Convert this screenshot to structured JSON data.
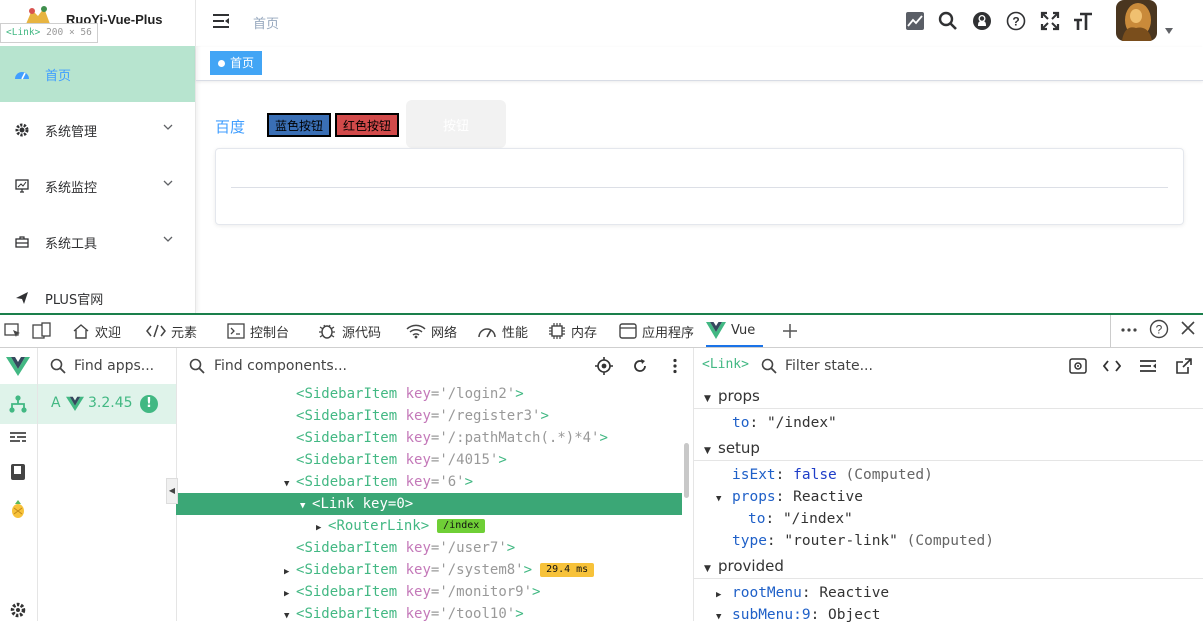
{
  "app": {
    "title": "RuoYi-Vue-Plus",
    "breadcrumb": "首页",
    "tag_home": "首页",
    "menu": [
      {
        "label": "首页",
        "icon": "dashboard-icon",
        "active": true
      },
      {
        "label": "系统管理",
        "icon": "gear-icon"
      },
      {
        "label": "系统监控",
        "icon": "monitor-icon"
      },
      {
        "label": "系统工具",
        "icon": "toolbox-icon"
      },
      {
        "label": "PLUS官网",
        "icon": "send-icon"
      }
    ],
    "header_icons": [
      "chart-icon",
      "search-icon",
      "github-icon",
      "help-icon",
      "fullscreen-icon",
      "font-size-icon"
    ],
    "main": {
      "link": "百度",
      "btn_blue": "蓝色按钮",
      "btn_red": "红色按钮",
      "btn_plain": "按钮"
    }
  },
  "inspect_tooltip": {
    "tag": "<Link>",
    "size": "200 × 56"
  },
  "devtools": {
    "tabs": [
      "欢迎",
      "元素",
      "控制台",
      "源代码",
      "网络",
      "性能",
      "内存",
      "应用程序",
      "Vue"
    ],
    "active_tab": "Vue",
    "find_apps_placeholder": "Find apps...",
    "app_letter": "A",
    "app_version": "3.2.45",
    "app_warning": "!",
    "find_components_placeholder": "Find components...",
    "tree": [
      {
        "indent": 0,
        "arrow": "",
        "name": "SidebarItem",
        "key": "'/login2'"
      },
      {
        "indent": 0,
        "arrow": "",
        "name": "SidebarItem",
        "key": "'/register3'"
      },
      {
        "indent": 0,
        "arrow": "",
        "name": "SidebarItem",
        "key": "'/:pathMatch(.*)*4'"
      },
      {
        "indent": 0,
        "arrow": "",
        "name": "SidebarItem",
        "key": "'/4015'"
      },
      {
        "indent": 0,
        "arrow": "▼",
        "name": "SidebarItem",
        "key": "'6'"
      },
      {
        "indent": 1,
        "arrow": "▼",
        "name": "Link",
        "key": "0",
        "selected": true
      },
      {
        "indent": 2,
        "arrow": "▶",
        "name": "RouterLink",
        "badge": "/index"
      },
      {
        "indent": 0,
        "arrow": "",
        "name": "SidebarItem",
        "key": "'/user7'"
      },
      {
        "indent": 0,
        "arrow": "▶",
        "name": "SidebarItem",
        "key": "'/system8'",
        "timing": "29.4 ms"
      },
      {
        "indent": 0,
        "arrow": "▶",
        "name": "SidebarItem",
        "key": "'/monitor9'"
      },
      {
        "indent": 0,
        "arrow": "▼",
        "name": "SidebarItem",
        "key": "'/tool10'"
      }
    ],
    "state_title": "<Link>",
    "filter_state_placeholder": "Filter state...",
    "sections": {
      "props": "props",
      "setup": "setup",
      "provided": "provided"
    },
    "props_rows": [
      {
        "key": "to",
        "value": "\"/index\""
      }
    ],
    "setup_rows": [
      {
        "key": "isExt",
        "value": "false",
        "note": "(Computed)"
      },
      {
        "key": "props",
        "value": "Reactive",
        "arrow": "▼"
      },
      {
        "key": "to",
        "value": "\"/index\"",
        "nested": true
      },
      {
        "key": "type",
        "value": "\"router-link\"",
        "note": "(Computed)"
      }
    ],
    "provided_rows": [
      {
        "key": "rootMenu",
        "value": "Reactive",
        "arrow": "▶"
      },
      {
        "key": "subMenu:9",
        "value": "Object",
        "arrow": "▼"
      }
    ]
  },
  "colors": {
    "vue_green": "#42b883",
    "menu_active_bg": "#b7e4cf",
    "devtools_accent": "#1a7f4b",
    "link_blue": "#409eff"
  }
}
